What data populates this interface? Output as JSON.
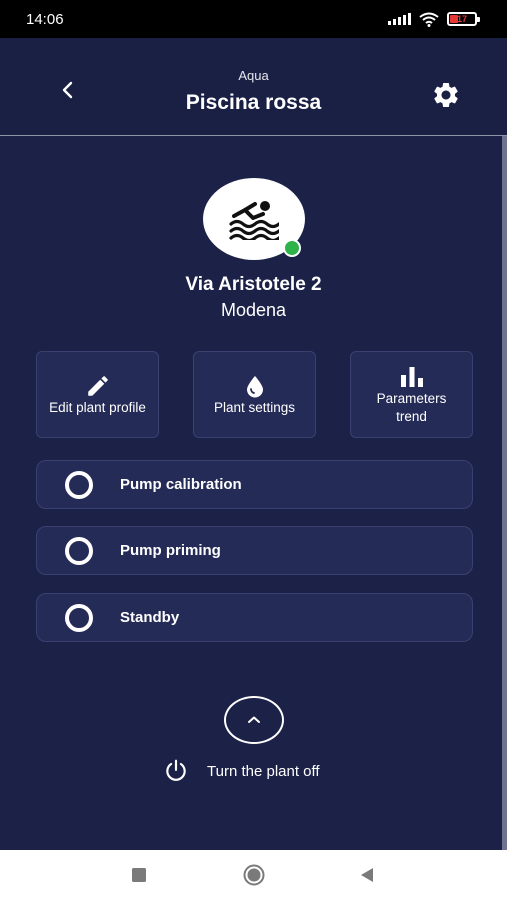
{
  "status_bar": {
    "time": "14:06",
    "battery": "17",
    "icons": [
      "signal-icon",
      "wifi-icon",
      "battery-icon"
    ]
  },
  "header": {
    "subtitle": "Aqua",
    "title": "Piscina rossa",
    "back_icon": "chevron-left-icon",
    "settings_icon": "gear-icon"
  },
  "plant": {
    "avatar_icon": "swimmer-icon",
    "online": true,
    "address": "Via Aristotele 2",
    "city": "Modena"
  },
  "cards": [
    {
      "label": "Edit plant profile",
      "icon": "pencil-icon"
    },
    {
      "label": "Plant settings",
      "icon": "water-drop-icon"
    },
    {
      "label": "Parameters trend",
      "icon": "bar-chart-icon"
    }
  ],
  "modes": [
    {
      "label": "Pump calibration",
      "selected": false
    },
    {
      "label": "Pump priming",
      "selected": false
    },
    {
      "label": "Standby",
      "selected": false
    }
  ],
  "footer": {
    "expand_icon": "chevron-up-icon",
    "power_icon": "power-icon",
    "turn_off_label": "Turn the plant off"
  },
  "colors": {
    "background": "#1c2147",
    "card": "#252b57",
    "online": "#2eb34a",
    "battery_low": "#e53935"
  },
  "nav": [
    "recent-apps-icon",
    "home-icon",
    "back-icon"
  ]
}
